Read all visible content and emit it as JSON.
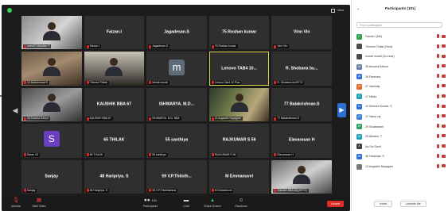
{
  "zoom": {
    "view_label": "View",
    "tiles": [
      {
        "name": "",
        "label": "pranaTi Makolan S",
        "video": "vid-a"
      },
      {
        "name": "Faizan.I",
        "label": "Faizan.I"
      },
      {
        "name": "Jagadesan.S",
        "label": "Jagadesan.S"
      },
      {
        "name": "75 Roshan kumar",
        "label": "75 Roshan kumar"
      },
      {
        "name": "Vinn Vin",
        "label": "Vinn Vin"
      },
      {
        "name": "",
        "label": "10 Muhammad S",
        "video": "vid-b"
      },
      {
        "name": "",
        "label": "Thinesh Thilak",
        "video": "vid-c"
      },
      {
        "name": "",
        "label": "Murali murali",
        "avatar": "m"
      },
      {
        "name": "Lenovo TAB4 10...",
        "label": "Lenovo Tab4 10 Plus",
        "highlight": true
      },
      {
        "name": "R. Shobana bu...",
        "label": "R. Shobana bu20772"
      },
      {
        "name": "",
        "label": "26 Anusha Edison",
        "video": "vid-d"
      },
      {
        "name": "KAUSHIK BBA 67",
        "label": "KAUSHIK BBA 67"
      },
      {
        "name": "ISHWARYA. M.D...",
        "label": "ISHWARYA. M.D. BBA"
      },
      {
        "name": "",
        "label": "13 Augastin Nayagam",
        "video": "vid-e"
      },
      {
        "name": "77 Balakrishnan.S",
        "label": "77 Balakrishnan.S"
      },
      {
        "name": "",
        "label": "Saran 15",
        "avatar": "S"
      },
      {
        "name": "65 THILAK",
        "label": "65 THILAK"
      },
      {
        "name": "55 santhiya",
        "label": "55 santhiya"
      },
      {
        "name": "RAJKUMAR S 56",
        "label": "RAJKUMAR S 56"
      },
      {
        "name": "Elavarasan H",
        "label": "Elavarasan H"
      },
      {
        "name": "Sanjay",
        "label": "Sanjay"
      },
      {
        "name": "48 Haripriya. S",
        "label": "48 Haripriya. S"
      },
      {
        "name": "59 V.P.Thiloth...",
        "label": "59 V.P.Thilothamma"
      },
      {
        "name": "M Emmanuvel",
        "label": "M Emmanuvel"
      },
      {
        "name": "",
        "label": "Srimathi BBA 68/(49772)",
        "video": "vid-f"
      }
    ],
    "toolbar": {
      "unmute": "Unmute",
      "start_video": "Start Video",
      "participants": "Participants",
      "participants_count": "101",
      "chat": "Chat",
      "share_screen": "Share Screen",
      "reactions": "Reactions",
      "end": "Leave"
    }
  },
  "panel": {
    "title": "Participants (101)",
    "search_placeholder": "Find a participant",
    "participants": [
      {
        "initials": "F",
        "color": "#2ea44f",
        "name": "Faizan.I (Me)"
      },
      {
        "initials": "",
        "color": "#4a4a4a",
        "name": "Thinesh Thilak (Host)"
      },
      {
        "initials": "",
        "color": "#4a4a4a",
        "name": "murali murali (Co-host)"
      },
      {
        "initials": "26",
        "color": "#6d7ea8",
        "name": "26 Anusha Edison"
      },
      {
        "initials": "26",
        "color": "#2f6fd6",
        "name": "26 Parimala"
      },
      {
        "initials": "07",
        "color": "#e26b2c",
        "name": "07 Vaishaly"
      },
      {
        "initials": "17",
        "color": "#1f9fb8",
        "name": "17 Nihila"
      },
      {
        "initials": "10",
        "color": "#2f6fd6",
        "name": "10 Mohesh Kumar. S"
      },
      {
        "initials": "17",
        "color": "#3b7fd6",
        "name": "17 Varun raj"
      },
      {
        "initials": "29",
        "color": "#2aa168",
        "name": "29 Sivatharani"
      },
      {
        "initials": "29",
        "color": "#1f9fb8",
        "name": "29 Abirami. T"
      },
      {
        "initials": "A",
        "color": "#3a3a3a",
        "name": "Aa Sai Sanit"
      },
      {
        "initials": "46",
        "color": "#2f6fd6",
        "name": "46 Haripriya. S"
      },
      {
        "initials": "",
        "color": "#777777",
        "name": "13 Augastin Nayagam"
      }
    ],
    "invite_label": "Invite",
    "unmute_me_label": "Unmute Me"
  }
}
